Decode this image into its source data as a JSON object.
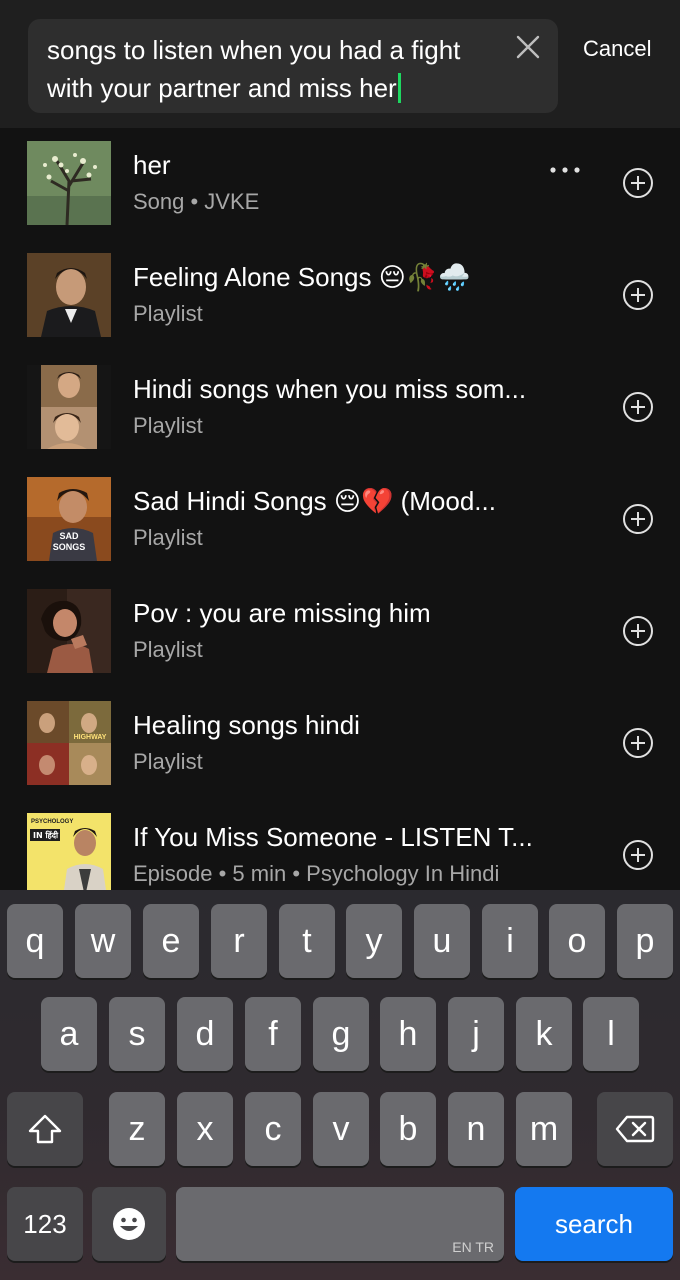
{
  "search": {
    "query": "songs to listen when you had a fight with your partner and miss her",
    "cancel_label": "Cancel"
  },
  "results": [
    {
      "title": "her",
      "subtitle": "Song • JVKE",
      "has_more": true
    },
    {
      "title": "Feeling Alone Songs 😔🥀🌧️",
      "subtitle": "Playlist"
    },
    {
      "title": "Hindi songs when you miss som...",
      "subtitle": "Playlist"
    },
    {
      "title": "Sad Hindi Songs 😔💔 (Mood...",
      "subtitle": "Playlist",
      "thumb_text": "SAD SONGS"
    },
    {
      "title": "Pov : you are missing him",
      "subtitle": "Playlist"
    },
    {
      "title": "Healing songs hindi",
      "subtitle": "Playlist",
      "thumb_text": "HIGHWAY"
    },
    {
      "title": "If You Miss Someone - LISTEN T...",
      "subtitle": "Episode • 5 min • Psychology In Hindi",
      "thumb_text": "PSYCHOLOGY IN हिंदी"
    }
  ],
  "keyboard": {
    "row1": [
      "q",
      "w",
      "e",
      "r",
      "t",
      "y",
      "u",
      "i",
      "o",
      "p"
    ],
    "row2": [
      "a",
      "s",
      "d",
      "f",
      "g",
      "h",
      "j",
      "k",
      "l"
    ],
    "row3": [
      "z",
      "x",
      "c",
      "v",
      "b",
      "n",
      "m"
    ],
    "numbers_label": "123",
    "search_label": "search",
    "language_label": "EN TR"
  },
  "colors": {
    "accent": "#1ed760",
    "background": "#121212",
    "search_key": "#1479f0"
  },
  "icons": [
    "close-icon",
    "more-icon",
    "add-icon",
    "shift-icon",
    "backspace-icon",
    "emoji-icon"
  ]
}
